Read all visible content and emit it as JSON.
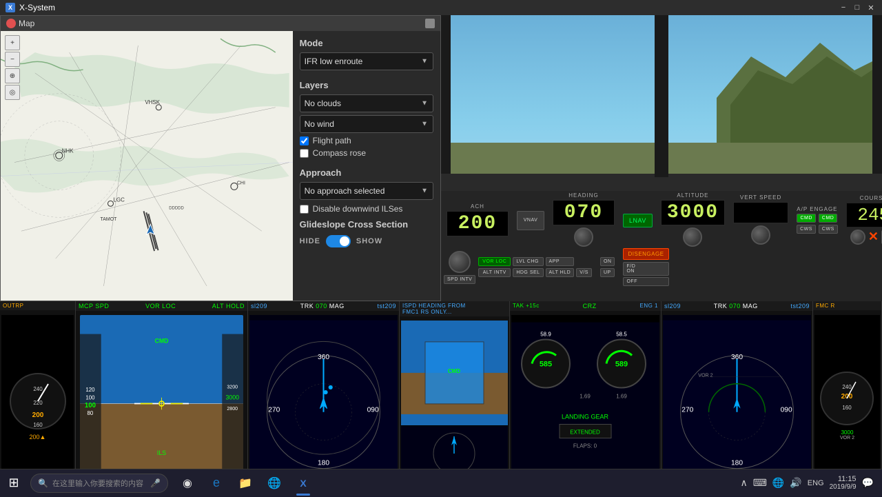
{
  "titlebar": {
    "title": "X-System",
    "close": "✕",
    "maximize": "□",
    "minimize": "−"
  },
  "map_window": {
    "title": "Map",
    "mode_label": "Mode",
    "mode_value": "IFR low enroute",
    "layers_label": "Layers",
    "layer1": "No clouds",
    "layer2": "No wind",
    "flight_path_label": "Flight path",
    "compass_rose_label": "Compass rose",
    "flight_path_checked": true,
    "compass_rose_checked": false,
    "approach_label": "Approach",
    "approach_value": "No approach selected",
    "disable_downwind_label": "Disable downwind ILSes",
    "glideslope_label": "Glideslope Cross Section",
    "hide_label": "HIDE",
    "show_label": "SHOW"
  },
  "autopilot": {
    "heading_label": "HEADING",
    "heading_value": "070",
    "lnav_label": "LNAV",
    "altitude_label": "ALTITUDE",
    "altitude_value": "3000",
    "vert_speed_label": "VERT SPEED",
    "vert_speed_value": "",
    "ap_engage_label": "A/P ENGAGE",
    "course_label": "COURSE",
    "course_value": "245",
    "cmd_label": "CMD",
    "cws_label": "CWS",
    "fo_label": "F/D\nON",
    "vnav_label": "VNAV",
    "spd_label": "SPD\nINTV",
    "lvl_chg_label": "LVL CHG",
    "hdg_sel_label": "HDG SEL",
    "app_label": "APP",
    "alt_hld_label": "ALT HLD",
    "vs_label": "V/S",
    "vor_loc_label": "VOR LOC",
    "alt_label": "ALT\nINTV",
    "disengage_label": "DISENGAGE",
    "on_label": "ON",
    "up_label": "UP",
    "ach_label": "ACH",
    "speed_value": "200"
  },
  "pfd": {
    "mcp_spd_label": "MCP SPD",
    "vor_loc_label": "VOR LOC",
    "alt_hold_label": "ALT HOLD",
    "speed": "100",
    "altitude": "3000",
    "cmd_label": "CMD",
    "ils_label": "ILS"
  },
  "nd": {
    "trk_label": "TRK",
    "heading": "070",
    "mag_label": "MAG"
  },
  "taskbar": {
    "search_placeholder": "在这里输入你要搜索的内容",
    "time": "11:15",
    "date": "2019/9/9",
    "language": "ENG",
    "start_icon": "⊞"
  },
  "cockpit_right": {
    "speed_display": "200",
    "heading_display": "070",
    "altitude_display": "3000",
    "course_display": "245"
  }
}
